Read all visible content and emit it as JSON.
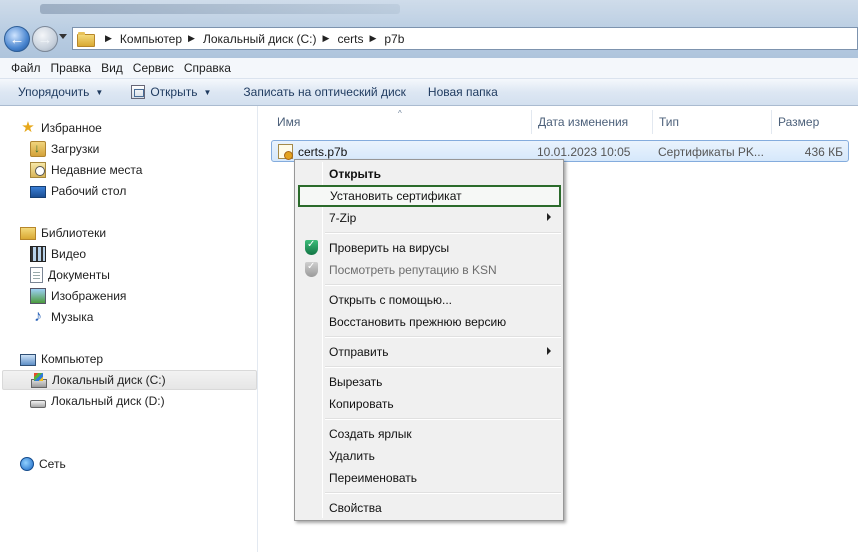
{
  "address_bar": {
    "crumbs": [
      "Компьютер",
      "Локальный диск (C:)",
      "certs",
      "p7b"
    ]
  },
  "menu_bar": {
    "items": [
      "Файл",
      "Правка",
      "Вид",
      "Сервис",
      "Справка"
    ]
  },
  "command_bar": {
    "organize": "Упорядочить",
    "open": "Открыть",
    "burn": "Записать на оптический диск",
    "new_folder": "Новая папка"
  },
  "nav_pane": {
    "favorites": "Избранное",
    "downloads": "Загрузки",
    "recent": "Недавние места",
    "desktop": "Рабочий стол",
    "libraries": "Библиотеки",
    "video": "Видео",
    "documents": "Документы",
    "images": "Изображения",
    "music": "Музыка",
    "computer": "Компьютер",
    "drive_c": "Локальный диск (C:)",
    "drive_d": "Локальный диск (D:)",
    "network": "Сеть"
  },
  "columns": {
    "name": "Имя",
    "date": "Дата изменения",
    "type": "Тип",
    "size": "Размер"
  },
  "file": {
    "name": "certs.p7b",
    "date": "10.01.2023 10:05",
    "type": "Сертификаты PK...",
    "size": "436 КБ"
  },
  "context_menu": {
    "open": "Открыть",
    "install_cert": "Установить сертификат",
    "zip": "7-Zip",
    "scan": "Проверить на вирусы",
    "ksn": "Посмотреть репутацию в KSN",
    "open_with": "Открыть с помощью...",
    "restore": "Восстановить прежнюю версию",
    "send_to": "Отправить",
    "cut": "Вырезать",
    "copy": "Копировать",
    "shortcut": "Создать ярлык",
    "delete": "Удалить",
    "rename": "Переименовать",
    "properties": "Свойства"
  }
}
